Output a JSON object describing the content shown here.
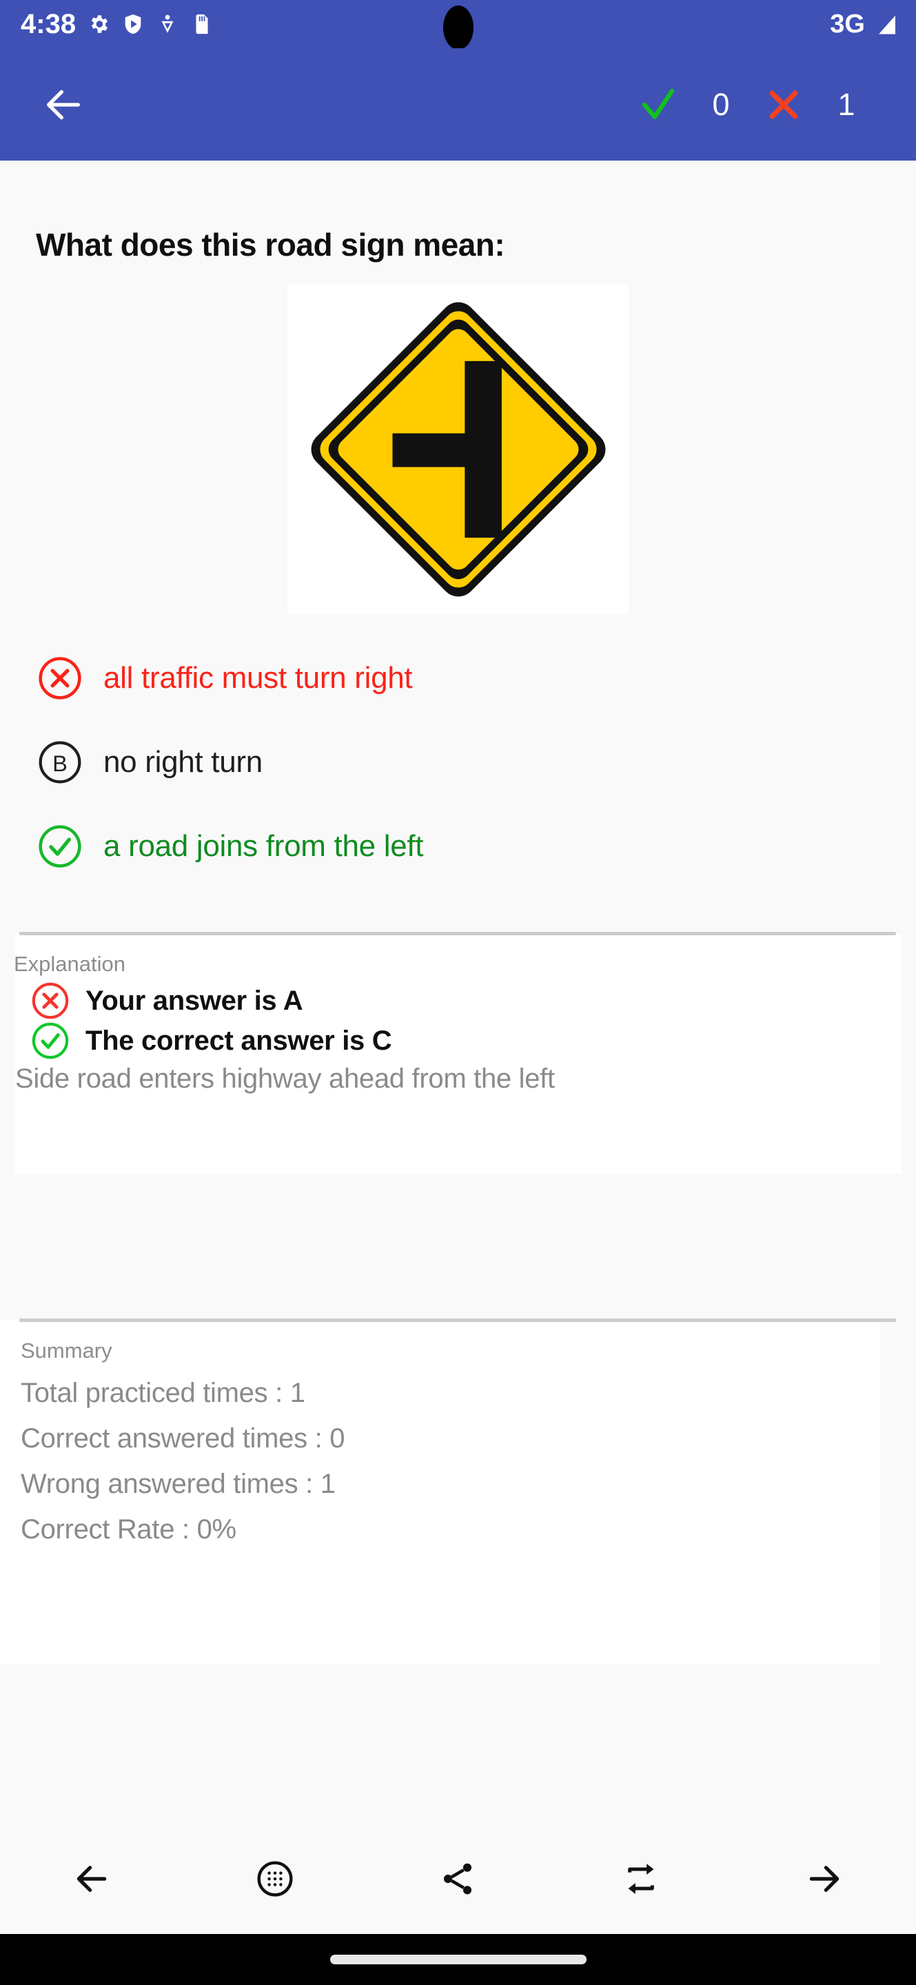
{
  "status_bar": {
    "time": "4:38",
    "network": "3G",
    "icons": [
      "gear-icon",
      "play-protect-icon",
      "heart-pulse-icon",
      "sd-card-icon"
    ],
    "signal_icon": "signal-bars-icon"
  },
  "app_bar": {
    "back_icon": "back-arrow-icon",
    "correct_icon": "check-icon",
    "correct_count": "0",
    "wrong_icon": "cross-icon",
    "wrong_count": "1",
    "background_color": "#3f51b5"
  },
  "question": {
    "prompt": "What does this road sign mean:",
    "sign": {
      "name": "side-road-left-warning-sign",
      "shape": "diamond",
      "background_color": "#FFCC00",
      "symbol_color": "#111111"
    }
  },
  "options": [
    {
      "key": "A",
      "label": "all traffic must turn right",
      "state": "wrong",
      "badge_icon": "circled-cross-icon",
      "color": "#fa2318"
    },
    {
      "key": "B",
      "label": "no right turn",
      "state": "neutral",
      "badge_icon": "circled-letter-b",
      "color": "#1f1f1f"
    },
    {
      "key": "C",
      "label": "a road joins from the left",
      "state": "correct",
      "badge_icon": "circled-check-icon",
      "color": "#0f8c1f"
    }
  ],
  "explanation": {
    "section_label": "Explanation",
    "your_answer": {
      "icon": "circled-cross-icon",
      "text": "Your answer is A"
    },
    "correct_answer": {
      "icon": "circled-check-icon",
      "text": "The correct answer is C"
    },
    "body": "Side road enters highway ahead from the left"
  },
  "summary": {
    "section_label": "Summary",
    "items": [
      "Total practiced times : 1",
      "Correct answered times : 0",
      "Wrong answered times : 1",
      "Correct Rate : 0%"
    ]
  },
  "bottom_nav": [
    {
      "name": "previous-button",
      "icon": "arrow-left-icon"
    },
    {
      "name": "grid-button",
      "icon": "dots-grid-circle-icon"
    },
    {
      "name": "share-button",
      "icon": "share-icon"
    },
    {
      "name": "repeat-button",
      "icon": "repeat-icon"
    },
    {
      "name": "next-button",
      "icon": "arrow-right-icon"
    }
  ],
  "colors": {
    "primary": "#3f51b5",
    "wrong": "#fa2318",
    "correct": "#0f8c1f",
    "correct_bright": "#00c020",
    "muted_text": "#8a8a8a",
    "page_bg": "#f9f9f9"
  }
}
